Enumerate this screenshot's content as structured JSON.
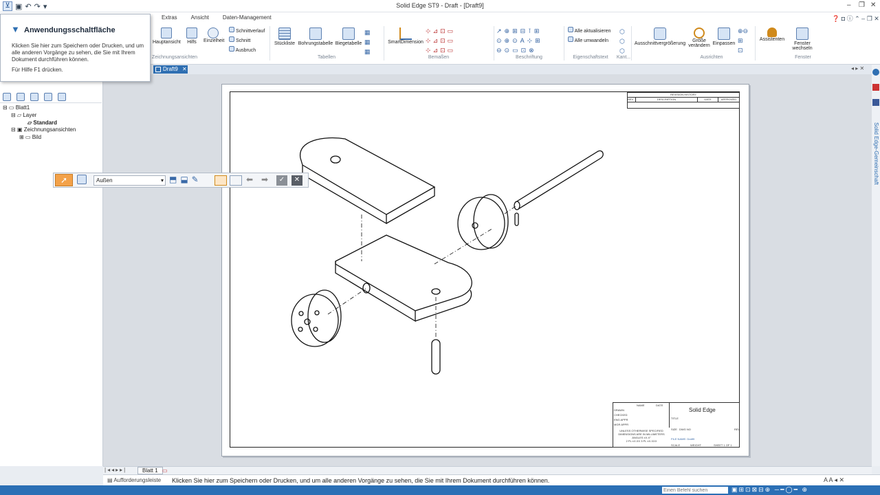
{
  "window": {
    "title": "Solid Edge ST9 - Draft - [Draft9]",
    "minimize": "–",
    "restore": "❐",
    "close": "✕"
  },
  "ribbon": {
    "tabs": [
      "Extras",
      "Ansicht",
      "Daten-Management"
    ],
    "groups": {
      "zeichnungsansichten": "Zeichnungsansichten",
      "tabellen": "Tabellen",
      "bemassen": "Bemaßen",
      "beschriftung": "Beschriftung",
      "eigenschaftstext": "Eigenschaftstext",
      "kanten": "Kant...",
      "ausrichten": "Ausrichten",
      "fenster": "Fenster"
    },
    "buttons": {
      "hauptansicht": "Hauptansicht",
      "hilfs": "Hilfs",
      "einzelheit": "Einzelheit",
      "schnittverlauf": "Schnittverlauf",
      "schnitt": "Schnitt",
      "ausbruch": "Ausbruch",
      "stueckliste": "Stückliste",
      "bohrungstabelle": "Bohrungstabelle",
      "biegetabelle": "Biegetabelle",
      "smartdimension": "SmartDimension",
      "alle_aktualisieren": "Alle aktualisieren",
      "alle_umwandeln": "Alle umwandeln",
      "ausschnittvergroesserung": "Ausschnittvergrößerung",
      "groesse_veraendern_1": "Größe",
      "groesse_veraendern_2": "verändern",
      "einpassen": "Einpassen",
      "assistenten": "Assistenten",
      "fenster_wechseln_1": "Fenster",
      "fenster_wechseln_2": "wechseln"
    }
  },
  "tooltip": {
    "title": "Anwendungsschaltfläche",
    "body": "Klicken Sie hier zum Speichern oder Drucken, und um alle anderen Vorgänge zu sehen, die Sie mit Ihrem Dokument durchführen können.",
    "footer": "Für Hilfe F1 drücken."
  },
  "document_tab": "Draft9",
  "tree": {
    "root": "Blatt1",
    "layer": "Layer",
    "standard": "Standard",
    "views": "Zeichnungsansichten",
    "bild": "Bild"
  },
  "cmdbar": {
    "select_value": "Außen"
  },
  "title_block": {
    "revision_history": "REVISION HISTORY",
    "rev": "REV",
    "description": "DESCRIPTION",
    "date": "DATE",
    "approved": "APPROVED",
    "name": "NAME",
    "date2": "DATE",
    "drawn": "DRAWN",
    "checked": "CHECKED",
    "eng_appr": "ENG APPR",
    "mgr_appr": "MGR APPR",
    "company": "Solid Edge",
    "title": "TITLE",
    "size": "SIZE",
    "dwg_no": "DWG NO",
    "rev2": "REV",
    "scale": "SCALE",
    "weight": "WEIGHT",
    "sheet": "SHEET 1 OF 1",
    "unless": "UNLESS OTHERWISE SPECIFIED",
    "dims": "DIMENSIONS ARE IN MILLIMETERS",
    "angles": "ANGLES ±X.X°",
    "tol": "2 PL ±X.XX 3 PL ±X.XXX",
    "file": "FILE NAME: Draft9"
  },
  "sheet_tab": "Blatt 1",
  "prompt": {
    "label": "Aufforderungsleiste",
    "text": "Klicken Sie hier zum Speichern oder Drucken, und um alle anderen Vorgänge zu sehen, die Sie mit Ihrem Dokument durchführen können."
  },
  "status": {
    "search_placeholder": "Einen Befehl suchen"
  },
  "right_rail": {
    "label": "Solid Edge-Gemeinschaft"
  }
}
